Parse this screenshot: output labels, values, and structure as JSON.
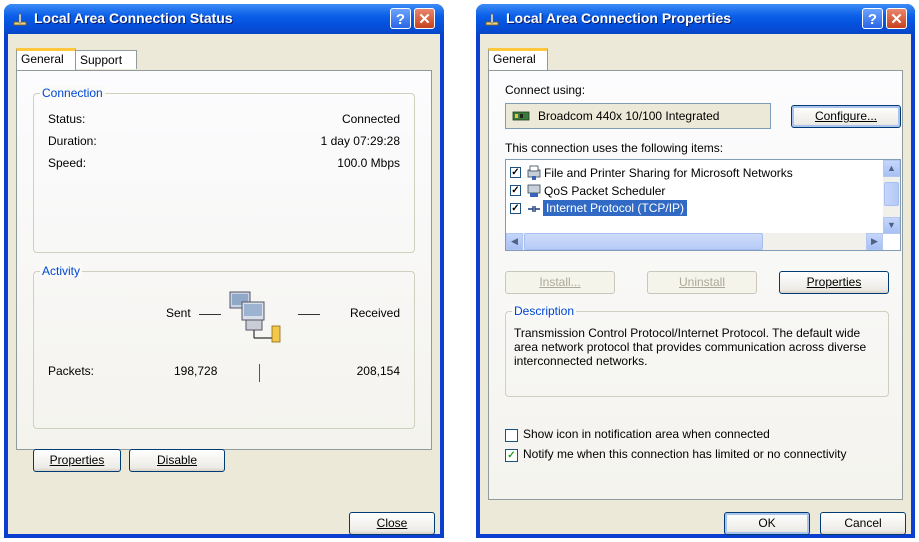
{
  "status_window": {
    "title": "Local Area Connection Status",
    "tabs": [
      "General",
      "Support"
    ],
    "connection": {
      "legend": "Connection",
      "status_label": "Status:",
      "status_value": "Connected",
      "duration_label": "Duration:",
      "duration_value": "1 day 07:29:28",
      "speed_label": "Speed:",
      "speed_value": "100.0 Mbps"
    },
    "activity": {
      "legend": "Activity",
      "sent_label": "Sent",
      "received_label": "Received",
      "packets_label": "Packets:",
      "packets_sent": "198,728",
      "packets_received": "208,154"
    },
    "properties_button": "Properties",
    "disable_button": "Disable",
    "close_button": "Close"
  },
  "properties_window": {
    "title": "Local Area Connection Properties",
    "tabs": [
      "General"
    ],
    "connect_using_label": "Connect using:",
    "adapter_name": "Broadcom 440x 10/100 Integrated",
    "configure_button": "Configure...",
    "items_label": "This connection uses the following items:",
    "items": [
      {
        "label": "File and Printer Sharing for Microsoft Networks",
        "checked": true,
        "selected": false
      },
      {
        "label": "QoS Packet Scheduler",
        "checked": true,
        "selected": false
      },
      {
        "label": "Internet Protocol (TCP/IP)",
        "checked": true,
        "selected": true
      }
    ],
    "install_button": "Install...",
    "uninstall_button": "Uninstall",
    "properties_button": "Properties",
    "description_legend": "Description",
    "description_text": "Transmission Control Protocol/Internet Protocol. The default wide area network protocol that provides communication across diverse interconnected networks.",
    "show_icon_label": "Show icon in notification area when connected",
    "show_icon_checked": false,
    "notify_label": "Notify me when this connection has limited or no connectivity",
    "notify_checked": true,
    "ok_button": "OK",
    "cancel_button": "Cancel"
  },
  "colors": {
    "titlebar": "#0a5fe8",
    "dialog_bg": "#ece9d8",
    "group_text": "#0046d5",
    "selection": "#316ac5"
  },
  "icons": [
    "network-plug-icon",
    "help-icon",
    "close-x-icon",
    "network-adapter-icon",
    "network-computers-icon",
    "printer-sharing-icon",
    "qos-icon",
    "protocol-icon"
  ]
}
